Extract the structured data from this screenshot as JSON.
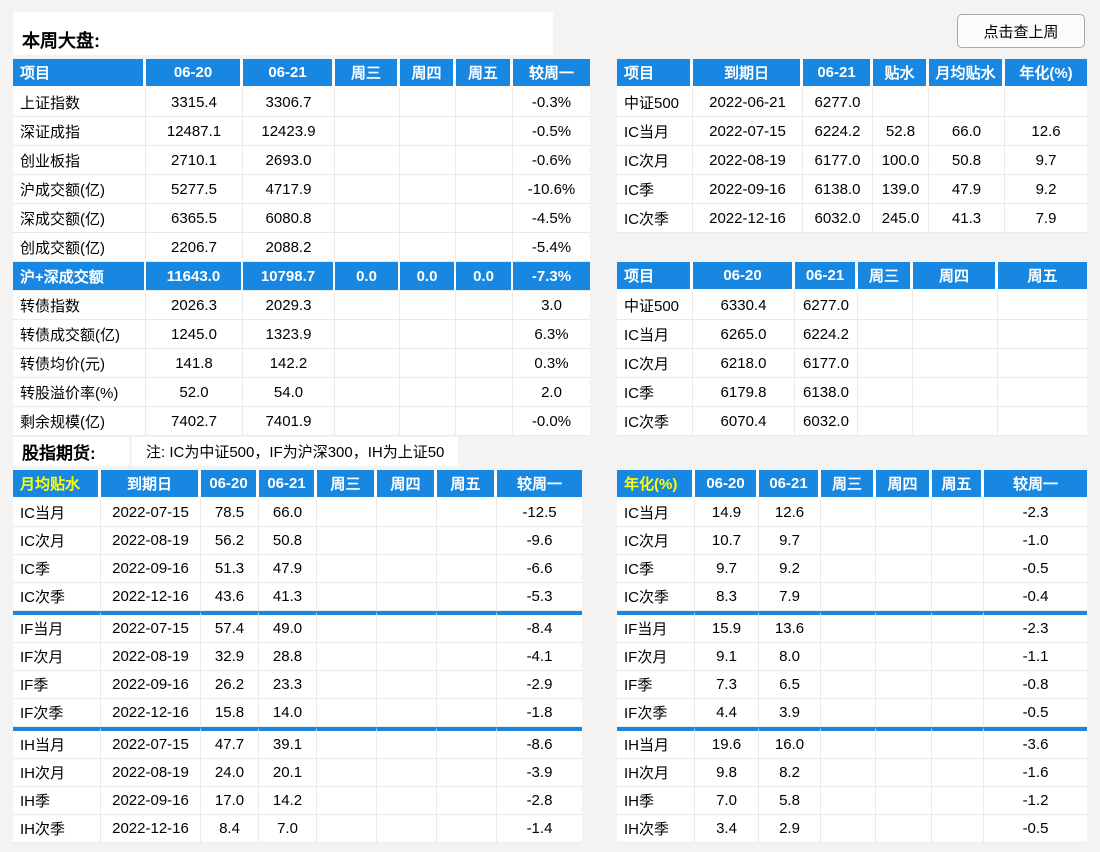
{
  "page": {
    "title": "本周大盘:",
    "last_week_button": "点击查上周",
    "futures_title": "股指期货:",
    "futures_note": "注: IC为中证500，IF为沪深300，IH为上证50"
  },
  "colors": {
    "header_blue": "#1787E1",
    "header_yellow": "#FFFF00"
  },
  "tables": {
    "market_week": {
      "headers": [
        "项目",
        "06-20",
        "06-21",
        "周三",
        "周四",
        "周五",
        "较周一"
      ],
      "highlight_row": 6,
      "rows": [
        [
          "上证指数",
          "3315.4",
          "3306.7",
          "",
          "",
          "",
          "-0.3%"
        ],
        [
          "深证成指",
          "12487.1",
          "12423.9",
          "",
          "",
          "",
          "-0.5%"
        ],
        [
          "创业板指",
          "2710.1",
          "2693.0",
          "",
          "",
          "",
          "-0.6%"
        ],
        [
          "沪成交额(亿)",
          "5277.5",
          "4717.9",
          "",
          "",
          "",
          "-10.6%"
        ],
        [
          "深成交额(亿)",
          "6365.5",
          "6080.8",
          "",
          "",
          "",
          "-4.5%"
        ],
        [
          "创成交额(亿)",
          "2206.7",
          "2088.2",
          "",
          "",
          "",
          "-5.4%"
        ],
        [
          "沪+深成交额",
          "11643.0",
          "10798.7",
          "0.0",
          "0.0",
          "0.0",
          "-7.3%"
        ],
        [
          "转债指数",
          "2026.3",
          "2029.3",
          "",
          "",
          "",
          "3.0"
        ],
        [
          "转债成交额(亿)",
          "1245.0",
          "1323.9",
          "",
          "",
          "",
          "6.3%"
        ],
        [
          "转债均价(元)",
          "141.8",
          "142.2",
          "",
          "",
          "",
          "0.3%"
        ],
        [
          "转股溢价率(%)",
          "52.0",
          "54.0",
          "",
          "",
          "",
          "2.0"
        ],
        [
          "剩余规模(亿)",
          "7402.7",
          "7401.9",
          "",
          "",
          "",
          "-0.0%"
        ]
      ]
    },
    "ic_term_structure": {
      "headers": [
        "项目",
        "到期日",
        "06-21",
        "贴水",
        "月均贴水",
        "年化(%)"
      ],
      "rows": [
        [
          "中证500",
          "2022-06-21",
          "6277.0",
          "",
          "",
          ""
        ],
        [
          "IC当月",
          "2022-07-15",
          "6224.2",
          "52.8",
          "66.0",
          "12.6"
        ],
        [
          "IC次月",
          "2022-08-19",
          "6177.0",
          "100.0",
          "50.8",
          "9.7"
        ],
        [
          "IC季",
          "2022-09-16",
          "6138.0",
          "139.0",
          "47.9",
          "9.2"
        ],
        [
          "IC次季",
          "2022-12-16",
          "6032.0",
          "245.0",
          "41.3",
          "7.9"
        ]
      ]
    },
    "ic_prices": {
      "headers": [
        "项目",
        "06-20",
        "06-21",
        "周三",
        "周四",
        "周五"
      ],
      "rows": [
        [
          "中证500",
          "6330.4",
          "6277.0",
          "",
          "",
          ""
        ],
        [
          "IC当月",
          "6265.0",
          "6224.2",
          "",
          "",
          ""
        ],
        [
          "IC次月",
          "6218.0",
          "6177.0",
          "",
          "",
          ""
        ],
        [
          "IC季",
          "6179.8",
          "6138.0",
          "",
          "",
          ""
        ],
        [
          "IC次季",
          "6070.4",
          "6032.0",
          "",
          "",
          ""
        ]
      ]
    },
    "monthly_basis": {
      "headers": [
        "月均贴水",
        "到期日",
        "06-20",
        "06-21",
        "周三",
        "周四",
        "周五",
        "较周一"
      ],
      "first_header_yellow": true,
      "separators_after": [
        3,
        7
      ],
      "rows": [
        [
          "IC当月",
          "2022-07-15",
          "78.5",
          "66.0",
          "",
          "",
          "",
          "-12.5"
        ],
        [
          "IC次月",
          "2022-08-19",
          "56.2",
          "50.8",
          "",
          "",
          "",
          "-9.6"
        ],
        [
          "IC季",
          "2022-09-16",
          "51.3",
          "47.9",
          "",
          "",
          "",
          "-6.6"
        ],
        [
          "IC次季",
          "2022-12-16",
          "43.6",
          "41.3",
          "",
          "",
          "",
          "-5.3"
        ],
        [
          "IF当月",
          "2022-07-15",
          "57.4",
          "49.0",
          "",
          "",
          "",
          "-8.4"
        ],
        [
          "IF次月",
          "2022-08-19",
          "32.9",
          "28.8",
          "",
          "",
          "",
          "-4.1"
        ],
        [
          "IF季",
          "2022-09-16",
          "26.2",
          "23.3",
          "",
          "",
          "",
          "-2.9"
        ],
        [
          "IF次季",
          "2022-12-16",
          "15.8",
          "14.0",
          "",
          "",
          "",
          "-1.8"
        ],
        [
          "IH当月",
          "2022-07-15",
          "47.7",
          "39.1",
          "",
          "",
          "",
          "-8.6"
        ],
        [
          "IH次月",
          "2022-08-19",
          "24.0",
          "20.1",
          "",
          "",
          "",
          "-3.9"
        ],
        [
          "IH季",
          "2022-09-16",
          "17.0",
          "14.2",
          "",
          "",
          "",
          "-2.8"
        ],
        [
          "IH次季",
          "2022-12-16",
          "8.4",
          "7.0",
          "",
          "",
          "",
          "-1.4"
        ]
      ]
    },
    "annualized_basis": {
      "headers": [
        "年化(%)",
        "06-20",
        "06-21",
        "周三",
        "周四",
        "周五",
        "较周一"
      ],
      "first_header_yellow": true,
      "separators_after": [
        3,
        7
      ],
      "rows": [
        [
          "IC当月",
          "14.9",
          "12.6",
          "",
          "",
          "",
          "-2.3"
        ],
        [
          "IC次月",
          "10.7",
          "9.7",
          "",
          "",
          "",
          "-1.0"
        ],
        [
          "IC季",
          "9.7",
          "9.2",
          "",
          "",
          "",
          "-0.5"
        ],
        [
          "IC次季",
          "8.3",
          "7.9",
          "",
          "",
          "",
          "-0.4"
        ],
        [
          "IF当月",
          "15.9",
          "13.6",
          "",
          "",
          "",
          "-2.3"
        ],
        [
          "IF次月",
          "9.1",
          "8.0",
          "",
          "",
          "",
          "-1.1"
        ],
        [
          "IF季",
          "7.3",
          "6.5",
          "",
          "",
          "",
          "-0.8"
        ],
        [
          "IF次季",
          "4.4",
          "3.9",
          "",
          "",
          "",
          "-0.5"
        ],
        [
          "IH当月",
          "19.6",
          "16.0",
          "",
          "",
          "",
          "-3.6"
        ],
        [
          "IH次月",
          "9.8",
          "8.2",
          "",
          "",
          "",
          "-1.6"
        ],
        [
          "IH季",
          "7.0",
          "5.8",
          "",
          "",
          "",
          "-1.2"
        ],
        [
          "IH次季",
          "3.4",
          "2.9",
          "",
          "",
          "",
          "-0.5"
        ]
      ]
    }
  }
}
